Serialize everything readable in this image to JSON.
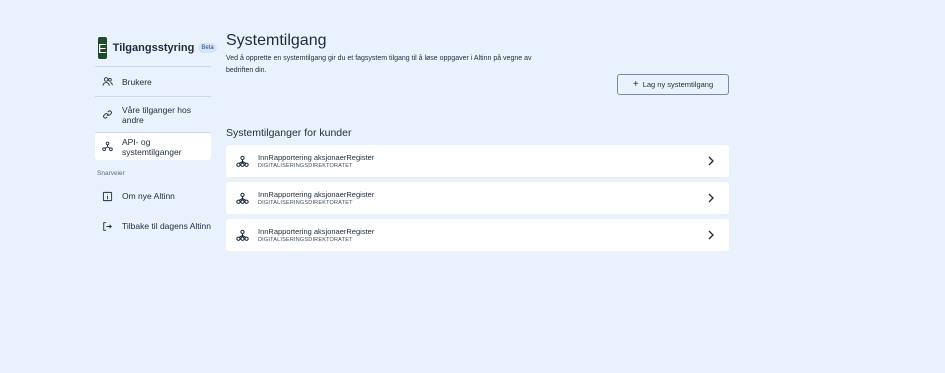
{
  "brand": {
    "logo_letter": "E",
    "title": "Tilgangsstyring",
    "badge": "Beta"
  },
  "sidebar": {
    "items": [
      {
        "label": "Brukere",
        "icon": "users-icon"
      },
      {
        "label": "Våre tilganger hos andre",
        "icon": "link-icon"
      },
      {
        "label": "API- og systemtilganger",
        "icon": "system-icon",
        "active": true
      }
    ],
    "shortcuts_label": "Snarveier",
    "shortcuts": [
      {
        "label": "Om nye Altinn",
        "icon": "info-icon"
      },
      {
        "label": "Tilbake til dagens Altinn",
        "icon": "leave-icon"
      }
    ]
  },
  "main": {
    "title": "Systemtilgang",
    "description": "Ved å opprette en systemtilgang gir du et fagsystem tilgang til å løse oppgaver i Altinn på vegne av bedriften din.",
    "add_button": "Lag ny systemtilgang",
    "section_title": "Systemtilganger for kunder",
    "systems": [
      {
        "name": "InnRapportering aksjonaerRegister",
        "org": "DIGITALISERINGSDIREKTORATET"
      },
      {
        "name": "InnRapportering aksjonaerRegister",
        "org": "DIGITALISERINGSDIREKTORATET"
      },
      {
        "name": "InnRapportering aksjonaerRegister",
        "org": "DIGITALISERINGSDIREKTORATET"
      }
    ]
  },
  "colors": {
    "background": "#e9f2fc",
    "logo": "#1f4a2a",
    "card": "#ffffff"
  }
}
